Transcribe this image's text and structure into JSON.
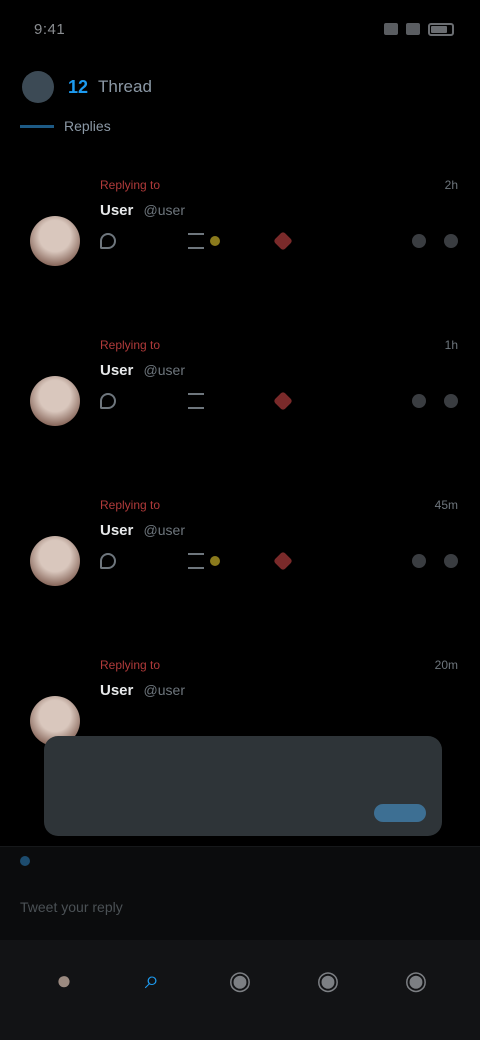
{
  "status": {
    "time": "9:41"
  },
  "top_bar": {
    "tweet_count": "12",
    "title": "Thread"
  },
  "thread_head": {
    "label": "Replies"
  },
  "tweets": [
    {
      "reply_tag": "Replying to",
      "time": "2h",
      "name": "User",
      "handle": "@user",
      "body": "",
      "link": "",
      "replies": "",
      "retweets": "",
      "likes": ""
    },
    {
      "reply_tag": "Replying to",
      "time": "1h",
      "name": "User",
      "handle": "@user",
      "body": "",
      "link": "",
      "replies": "",
      "retweets": "",
      "likes": ""
    },
    {
      "reply_tag": "Replying to",
      "time": "45m",
      "name": "User",
      "handle": "@user",
      "body": "",
      "link": "",
      "replies": "",
      "retweets": "",
      "likes": ""
    },
    {
      "reply_tag": "Replying to",
      "time": "20m",
      "name": "User",
      "handle": "@user",
      "body": "",
      "link": "",
      "replies": "",
      "retweets": "",
      "likes": ""
    }
  ],
  "quote": {
    "title": "",
    "text": ""
  },
  "reply_bar": {
    "strip_text": "",
    "placeholder": "Tweet your reply"
  },
  "tabs": [
    {
      "icon": "avatar-icon",
      "glyph": "●"
    },
    {
      "icon": "search-icon",
      "glyph": "⌕"
    },
    {
      "icon": "spaces-icon",
      "glyph": "◉"
    },
    {
      "icon": "notifications-icon",
      "glyph": "◉"
    },
    {
      "icon": "messages-icon",
      "glyph": "◉"
    }
  ]
}
